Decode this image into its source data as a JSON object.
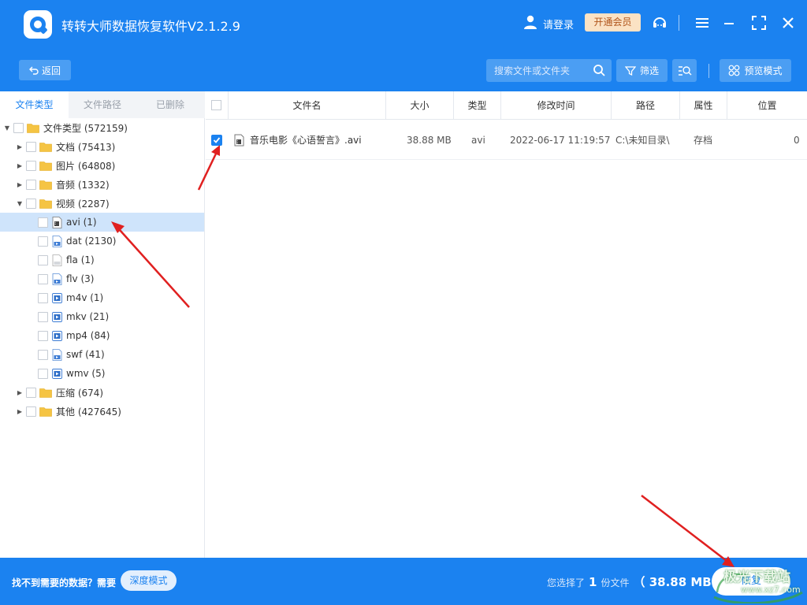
{
  "titlebar": {
    "app_title": "转转大师数据恢复软件V2.1.2.9",
    "login_label": "请登录",
    "vip_label": "开通会员",
    "icons": [
      "user-icon",
      "headset-icon",
      "menu-icon",
      "minimize-icon",
      "maximize-icon",
      "close-icon"
    ]
  },
  "toolbar": {
    "back_label": "返回",
    "search_placeholder": "搜索文件或文件夹",
    "filter_label": "筛选",
    "preview_label": "预览模式"
  },
  "left_tabs": [
    "文件类型",
    "文件路径",
    "已删除"
  ],
  "tree": [
    {
      "label": "文件类型 (572159)",
      "level": 0,
      "expanded": true,
      "kind": "folder"
    },
    {
      "label": "文档 (75413)",
      "level": 1,
      "expanded": false,
      "kind": "folder"
    },
    {
      "label": "图片 (64808)",
      "level": 1,
      "expanded": false,
      "kind": "folder"
    },
    {
      "label": "音频 (1332)",
      "level": 1,
      "expanded": false,
      "kind": "folder"
    },
    {
      "label": "视频 (2287)",
      "level": 1,
      "expanded": true,
      "kind": "folder"
    },
    {
      "label": "avi (1)",
      "level": 2,
      "kind": "film-file",
      "selected": true
    },
    {
      "label": "dat (2130)",
      "level": 2,
      "kind": "video-file"
    },
    {
      "label": "fla (1)",
      "level": 2,
      "kind": "blank-file"
    },
    {
      "label": "flv (3)",
      "level": 2,
      "kind": "video-file"
    },
    {
      "label": "m4v (1)",
      "level": 2,
      "kind": "media-file"
    },
    {
      "label": "mkv (21)",
      "level": 2,
      "kind": "media-file"
    },
    {
      "label": "mp4 (84)",
      "level": 2,
      "kind": "media-file"
    },
    {
      "label": "swf (41)",
      "level": 2,
      "kind": "video-file"
    },
    {
      "label": "wmv (5)",
      "level": 2,
      "kind": "media-file"
    },
    {
      "label": "压缩 (674)",
      "level": 1,
      "expanded": false,
      "kind": "folder"
    },
    {
      "label": "其他 (427645)",
      "level": 1,
      "expanded": false,
      "kind": "folder"
    }
  ],
  "table": {
    "columns": [
      "文件名",
      "大小",
      "类型",
      "修改时间",
      "路径",
      "属性",
      "位置"
    ],
    "rows": [
      {
        "checked": true,
        "name": "音乐电影《心语誓言》.avi",
        "size": "38.88 MB",
        "type": "avi",
        "modified": "2022-06-17 11:19:57",
        "path": "C:\\未知目录\\",
        "attr": "存档",
        "position": "0"
      }
    ]
  },
  "bottom": {
    "cant_find": "找不到需要的数据？需要",
    "deep_mode_label": "深度模式",
    "selected_prefix": "您选择了",
    "selected_count": "1",
    "selected_unit": "份文件",
    "selected_size": "（ 38.88 MB ）",
    "recover_label": "恢复"
  },
  "watermark": {
    "line1": "极光下载站",
    "line2": "www.xz7.com"
  },
  "colors": {
    "primary": "#1b82f0",
    "button_light": "#4b9ef3",
    "vip_bg": "#fbe2c4",
    "selected_row": "#cfe4fb",
    "folder": "#f5c443",
    "annotation_arrow": "#e02020"
  }
}
